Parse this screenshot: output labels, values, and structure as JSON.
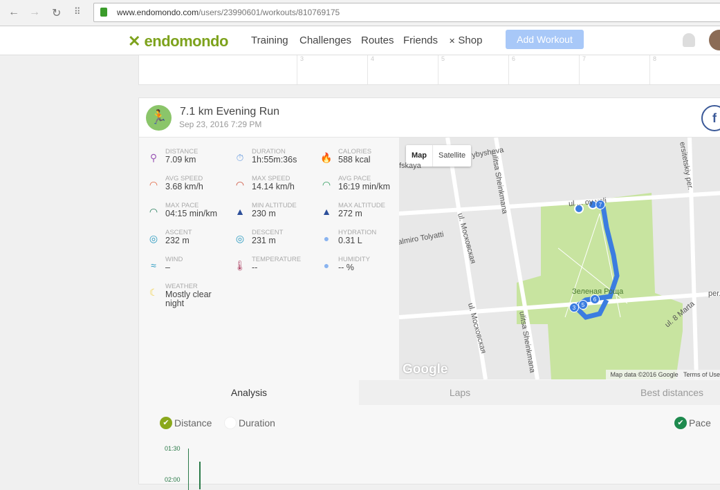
{
  "browser": {
    "url_host": "www.endomondo.com",
    "url_path": "/users/23990601/workouts/810769175"
  },
  "nav": {
    "logo": "endomondo",
    "items": [
      "Training",
      "Challenges",
      "Routes",
      "Friends",
      "Shop"
    ],
    "add_workout": "Add Workout"
  },
  "calendar": {
    "days": [
      "3",
      "4",
      "5",
      "6",
      "7",
      "8"
    ]
  },
  "workout": {
    "title": "7.1 km Evening Run",
    "date": "Sep 23, 2016 7:29 PM",
    "share": "f",
    "stats": [
      {
        "label": "DISTANCE",
        "value": "7.09 km",
        "icon": "distance-pin-icon",
        "color": "#9b59b6"
      },
      {
        "label": "DURATION",
        "value": "1h:55m:36s",
        "icon": "stopwatch-icon",
        "color": "#6a9de0"
      },
      {
        "label": "CALORIES",
        "value": "588 kcal",
        "icon": "flame-icon",
        "color": "#f06a3a"
      },
      {
        "label": "AVG SPEED",
        "value": "3.68 km/h",
        "icon": "speedometer-icon",
        "color": "#e0603a"
      },
      {
        "label": "MAX SPEED",
        "value": "14.14 km/h",
        "icon": "speedometer-icon",
        "color": "#c9452f"
      },
      {
        "label": "AVG PACE",
        "value": "16:19 min/km",
        "icon": "pace-gauge-icon",
        "color": "#2a9a5a"
      },
      {
        "label": "MAX PACE",
        "value": "04:15 min/km",
        "icon": "pace-gauge-icon",
        "color": "#1e7a56"
      },
      {
        "label": "MIN ALTITUDE",
        "value": "230 m",
        "icon": "mountain-icon",
        "color": "#2d4f9a"
      },
      {
        "label": "MAX ALTITUDE",
        "value": "272 m",
        "icon": "mountain-icon",
        "color": "#2d4f9a"
      },
      {
        "label": "ASCENT",
        "value": "232 m",
        "icon": "ascent-compass-icon",
        "color": "#2a9ac0"
      },
      {
        "label": "DESCENT",
        "value": "231 m",
        "icon": "descent-compass-icon",
        "color": "#2a9ac0"
      },
      {
        "label": "HYDRATION",
        "value": "0.31 L",
        "icon": "water-drops-icon",
        "color": "#8ab4f0"
      },
      {
        "label": "WIND",
        "value": "–",
        "icon": "wind-icon",
        "color": "#2a9ac0"
      },
      {
        "label": "TEMPERATURE",
        "value": "--",
        "icon": "thermometer-icon",
        "color": "#b04a6a"
      },
      {
        "label": "HUMIDITY",
        "value": "-- %",
        "icon": "humidity-drops-icon",
        "color": "#8ab4f0"
      },
      {
        "label": "WEATHER",
        "value": "Mostly clear night",
        "icon": "moon-icon",
        "color": "#f2d04a"
      }
    ]
  },
  "map": {
    "type_map": "Map",
    "type_satellite": "Satellite",
    "attribution": "Map data ©2016 Google",
    "terms": "Terms of Use",
    "google": "Google",
    "labels": [
      "ybysheva",
      "fskaya",
      "ul. Московская",
      "ul. Московская",
      "ulitsa Sheinkmana",
      "ulitsa Sheinkmana",
      "almiro Tolyatti",
      "ersitetskiy per.",
      "ul ... oy voli",
      "Зеленая Роща",
      "per.",
      "ul. 8 Marta"
    ],
    "markers": [
      "3",
      "5",
      "6",
      "7"
    ],
    "route_color": "#3b7de0"
  },
  "tabs": [
    "Analysis",
    "Laps",
    "Best distances"
  ],
  "chart": {
    "options": [
      "Distance",
      "Duration",
      "Pace"
    ],
    "y_ticks": [
      "01:30",
      "02:00"
    ]
  }
}
